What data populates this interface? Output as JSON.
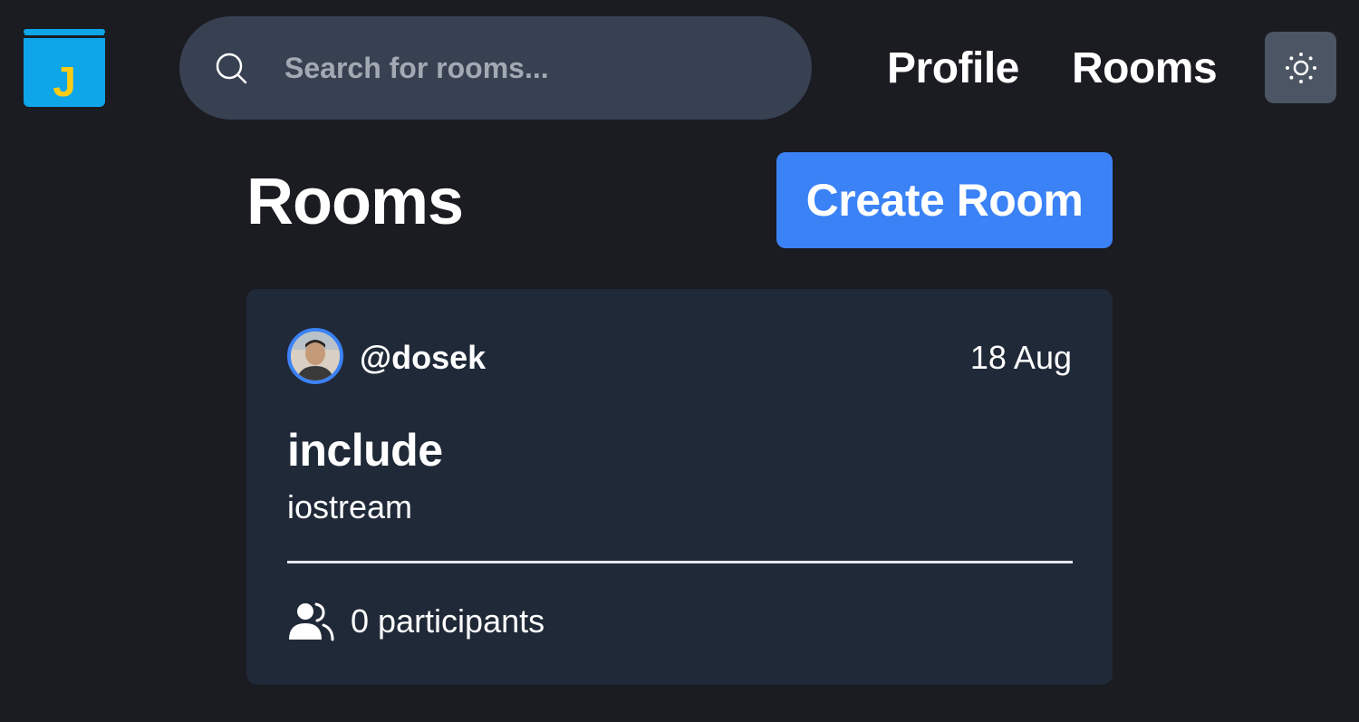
{
  "header": {
    "logo_letter": "J",
    "search": {
      "placeholder": "Search for rooms...",
      "value": ""
    },
    "nav": {
      "profile": "Profile",
      "rooms": "Rooms"
    },
    "theme_toggle_icon": "sun-icon"
  },
  "main": {
    "title": "Rooms",
    "create_button": "Create Room"
  },
  "rooms": [
    {
      "host": "@dosek",
      "date": "18 Aug",
      "name": "include",
      "topic": "iostream",
      "participants": "0 participants"
    }
  ],
  "colors": {
    "background": "#1b1b22",
    "search_bg": "#374151",
    "accent": "#3b82f6",
    "card_bg": "#202938",
    "logo_blue": "#0ea5e9",
    "logo_yellow": "#facc15"
  }
}
